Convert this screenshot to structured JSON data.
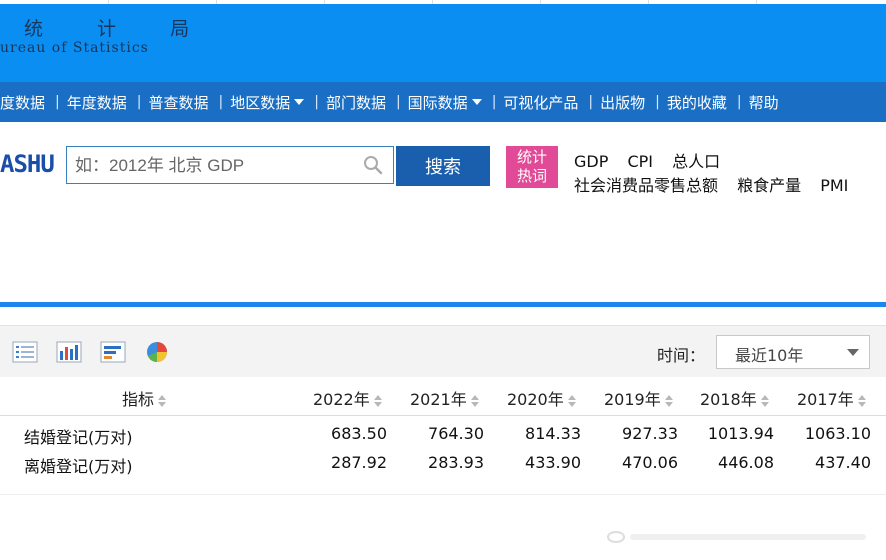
{
  "header": {
    "title": "统 计 局",
    "subtitle": "ureau of Statistics"
  },
  "nav": {
    "items": [
      {
        "label": "度数据",
        "dropdown": false
      },
      {
        "label": "年度数据",
        "dropdown": false
      },
      {
        "label": "普查数据",
        "dropdown": false
      },
      {
        "label": "地区数据",
        "dropdown": true
      },
      {
        "label": "部门数据",
        "dropdown": false
      },
      {
        "label": "国际数据",
        "dropdown": true
      },
      {
        "label": "可视化产品",
        "dropdown": false
      },
      {
        "label": "出版物",
        "dropdown": false
      },
      {
        "label": "我的收藏",
        "dropdown": false
      },
      {
        "label": "帮助",
        "dropdown": false
      }
    ],
    "separator": "|"
  },
  "search": {
    "logo": "ASHU",
    "placeholder": "如：2012年 北京 GDP",
    "button_label": "搜索"
  },
  "hot_words": {
    "badge_line1": "统计",
    "badge_line2": "热词",
    "row1": [
      "GDP",
      "CPI",
      "总人口"
    ],
    "row2": [
      "社会消费品零售总额",
      "粮食产量",
      "PMI"
    ]
  },
  "toolbar": {
    "icons": [
      "list-view-icon",
      "bar-chart-icon",
      "horizontal-bar-icon",
      "pie-chart-icon"
    ],
    "time_label": "时间：",
    "time_select_value": "最近10年"
  },
  "table": {
    "indicator_header": "指标",
    "years": [
      "2022年",
      "2021年",
      "2020年",
      "2019年",
      "2018年",
      "2017年"
    ],
    "rows": [
      {
        "label": "结婚登记(万对)",
        "values": [
          "683.50",
          "764.30",
          "814.33",
          "927.33",
          "1013.94",
          "1063.10"
        ]
      },
      {
        "label": "离婚登记(万对)",
        "values": [
          "287.92",
          "283.93",
          "433.90",
          "470.06",
          "446.08",
          "437.40"
        ]
      }
    ]
  },
  "colors": {
    "header_bg": "#0a8ef2",
    "nav_bg": "#1a6fc4",
    "search_button": "#1a5fad",
    "hot_badge": "#e04a96",
    "accent_bar": "#1a86ee"
  }
}
